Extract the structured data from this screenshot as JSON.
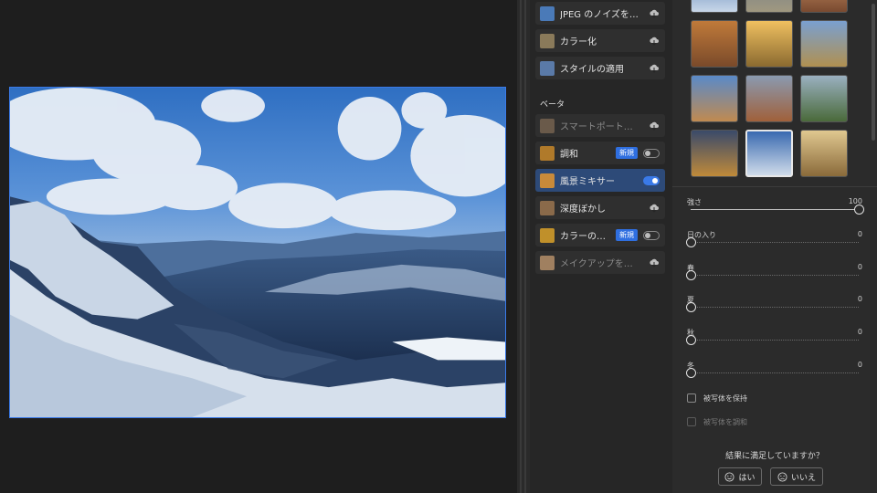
{
  "filters": {
    "items": [
      {
        "label": "JPEG のノイズを…",
        "action": "cloud",
        "thumb_color": "#4a7ab8"
      },
      {
        "label": "カラー化",
        "action": "cloud",
        "thumb_color": "#8a7a5a"
      },
      {
        "label": "スタイルの適用",
        "action": "cloud",
        "thumb_color": "#5a7aa8"
      }
    ],
    "beta_label": "ベータ",
    "beta_items": [
      {
        "label": "スマートポート…",
        "action": "cloud",
        "thumb_color": "#6a5a4a",
        "disabled": true
      },
      {
        "label": "調和",
        "badge": "新規",
        "toggle": false,
        "thumb_color": "#b07a2a"
      },
      {
        "label": "風景ミキサー",
        "toggle": true,
        "selected": true,
        "thumb_color": "#c88a3a"
      },
      {
        "label": "深度ぼかし",
        "action": "cloud",
        "thumb_color": "#8a6a4a"
      },
      {
        "label": "カラーの…",
        "badge": "新規",
        "toggle": false,
        "thumb_color": "#c0902a"
      },
      {
        "label": "メイクアップを…",
        "action": "cloud",
        "thumb_color": "#a08060",
        "disabled": true
      }
    ]
  },
  "settings": {
    "sliders": [
      {
        "name": "強さ",
        "value": "100",
        "fraction": 1.0
      },
      {
        "name": "日の入り",
        "value": "0",
        "fraction": 0
      },
      {
        "name": "春",
        "value": "0",
        "fraction": 0
      },
      {
        "name": "夏",
        "value": "0",
        "fraction": 0
      },
      {
        "name": "秋",
        "value": "0",
        "fraction": 0
      },
      {
        "name": "冬",
        "value": "0",
        "fraction": 0
      }
    ],
    "checkboxes": [
      {
        "label": "被写体を保持",
        "disabled": false
      },
      {
        "label": "被写体を調和",
        "disabled": true
      }
    ]
  },
  "feedback": {
    "question": "結果に満足していますか？",
    "yes": "はい",
    "no": "いいえ"
  },
  "colors": {
    "accent": "#3a7ae8",
    "selected_bg": "#2d4a78",
    "badge": "#2f6fe0"
  }
}
